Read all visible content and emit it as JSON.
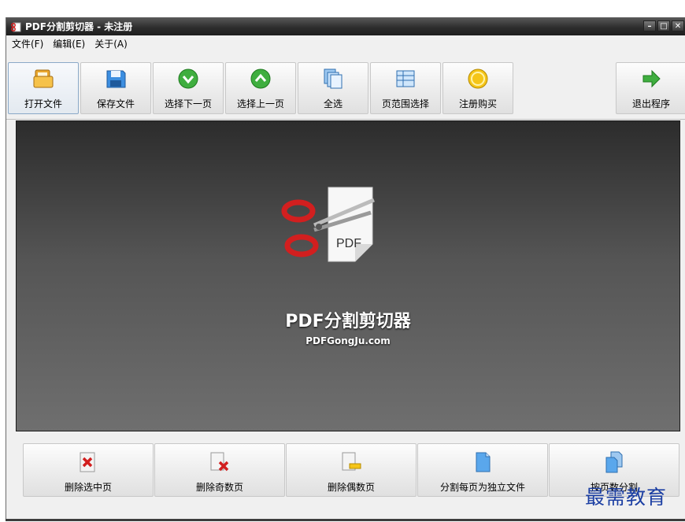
{
  "window": {
    "title": "PDF分割剪切器 - 未注册",
    "controls": [
      "–",
      "□",
      "✕"
    ]
  },
  "menu": [
    {
      "label": "文件(F)"
    },
    {
      "label": "编辑(E)"
    },
    {
      "label": "关于(A)"
    }
  ],
  "toolbar": [
    {
      "label": "打开文件",
      "icon": "folder-icon"
    },
    {
      "label": "保存文件",
      "icon": "floppy-disk-icon"
    },
    {
      "label": "选择下一页",
      "icon": "arrow-down-circle-icon"
    },
    {
      "label": "选择上一页",
      "icon": "arrow-up-circle-icon"
    },
    {
      "label": "全选",
      "icon": "pages-stack-icon"
    },
    {
      "label": "页范围选择",
      "icon": "page-range-icon"
    },
    {
      "label": "注册购买",
      "icon": "coin-icon"
    },
    {
      "label": "退出程序",
      "icon": "exit-arrow-icon"
    }
  ],
  "viewer": {
    "logo_text": "PDF",
    "title": "PDF分割剪切器",
    "url": "PDFGongJu.com"
  },
  "actions": [
    {
      "label": "删除选中页",
      "icon": "delete-page-icon"
    },
    {
      "label": "删除奇数页",
      "icon": "delete-odd-pages-icon"
    },
    {
      "label": "删除偶数页",
      "icon": "delete-even-pages-icon"
    },
    {
      "label": "分割每页为独立文件",
      "icon": "split-pages-icon"
    },
    {
      "label": "按页数分割",
      "icon": "split-by-count-icon"
    }
  ],
  "watermark": "最需教育",
  "colors": {
    "accent_green": "#3fae3f",
    "titlebar": "#2e2e2e",
    "watermark": "#1c3fa3",
    "scissor_red": "#d21f1f"
  }
}
